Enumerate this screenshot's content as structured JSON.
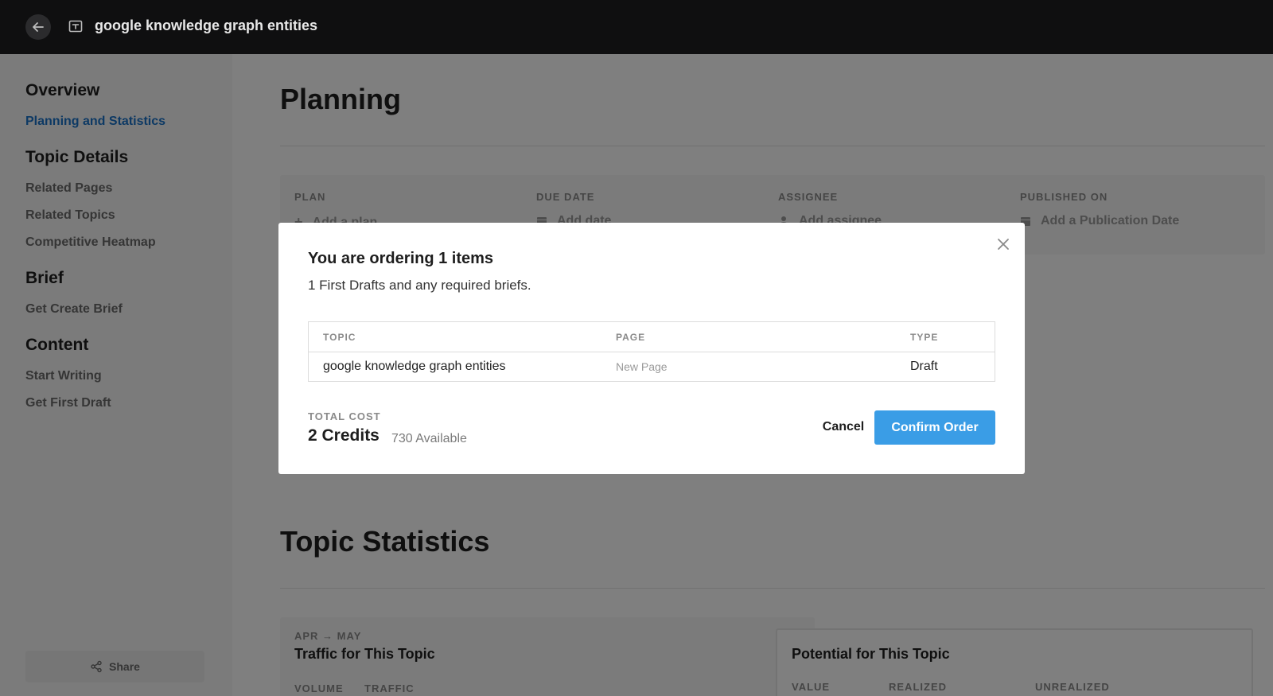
{
  "topbar": {
    "title": "google knowledge graph entities"
  },
  "sidebar": {
    "overview_heading": "Overview",
    "planning_link": "Planning and Statistics",
    "topic_details_heading": "Topic Details",
    "related_pages": "Related Pages",
    "related_topics": "Related Topics",
    "competitive_heatmap": "Competitive Heatmap",
    "brief_heading": "Brief",
    "get_create_brief": "Get Create Brief",
    "content_heading": "Content",
    "start_writing": "Start Writing",
    "get_first_draft": "Get First Draft",
    "share_label": "Share"
  },
  "main": {
    "planning_title": "Planning",
    "plan": {
      "plan_label": "PLAN",
      "plan_value": "Add a plan",
      "due_label": "DUE DATE",
      "due_value": "Add date",
      "assignee_label": "ASSIGNEE",
      "assignee_value": "Add assignee",
      "published_label": "PUBLISHED ON",
      "published_value": "Add a Publication Date"
    },
    "stats_title": "Topic Statistics",
    "traffic": {
      "period": "APR → MAY",
      "title": "Traffic for This Topic",
      "col1": "VOLUME",
      "col2": "TRAFFIC"
    },
    "potential": {
      "title": "Potential for This Topic",
      "col1": "VALUE",
      "col2": "REALIZED",
      "col3": "UNREALIZED"
    }
  },
  "modal": {
    "title": "You are ordering 1 items",
    "subtitle": "1 First Drafts and any required briefs.",
    "table": {
      "headers": [
        "TOPIC",
        "PAGE",
        "TYPE"
      ],
      "rows": [
        {
          "topic": "google knowledge graph entities",
          "page": "New Page",
          "type": "Draft"
        }
      ]
    },
    "total_cost_label": "TOTAL COST",
    "total_cost_value": "2 Credits",
    "available": "730 Available",
    "cancel_label": "Cancel",
    "confirm_label": "Confirm Order"
  },
  "colors": {
    "accent": "#3a9de6",
    "active_link": "#1a73c8",
    "topbar": "#0f0f10"
  }
}
